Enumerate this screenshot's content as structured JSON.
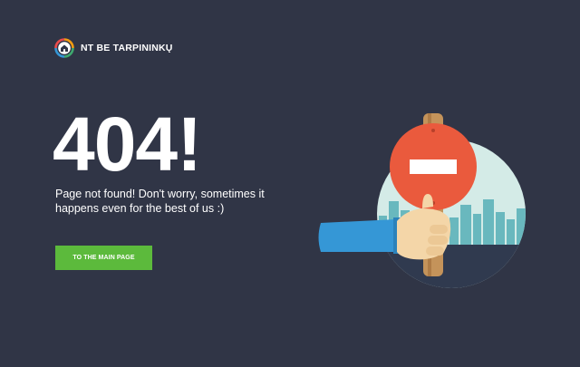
{
  "brand": {
    "name": "NT BE TARPININKŲ",
    "logo_icon": "house-icon"
  },
  "error": {
    "code": "404!",
    "message": "Page not found! Don't worry, sometimes it happens even for the best of us :)"
  },
  "actions": {
    "main_page_label": "TO THE MAIN PAGE"
  },
  "illustration": {
    "icon": "hand-holding-no-entry-sign",
    "colors": {
      "circle": "#d4ebe7",
      "sign": "#ea5a3d",
      "stick": "#c4935a",
      "sleeve": "#3597d6",
      "skyline": "#69b8be"
    }
  },
  "colors": {
    "background": "#303546",
    "accent": "#5cba3c",
    "text": "#ffffff"
  }
}
